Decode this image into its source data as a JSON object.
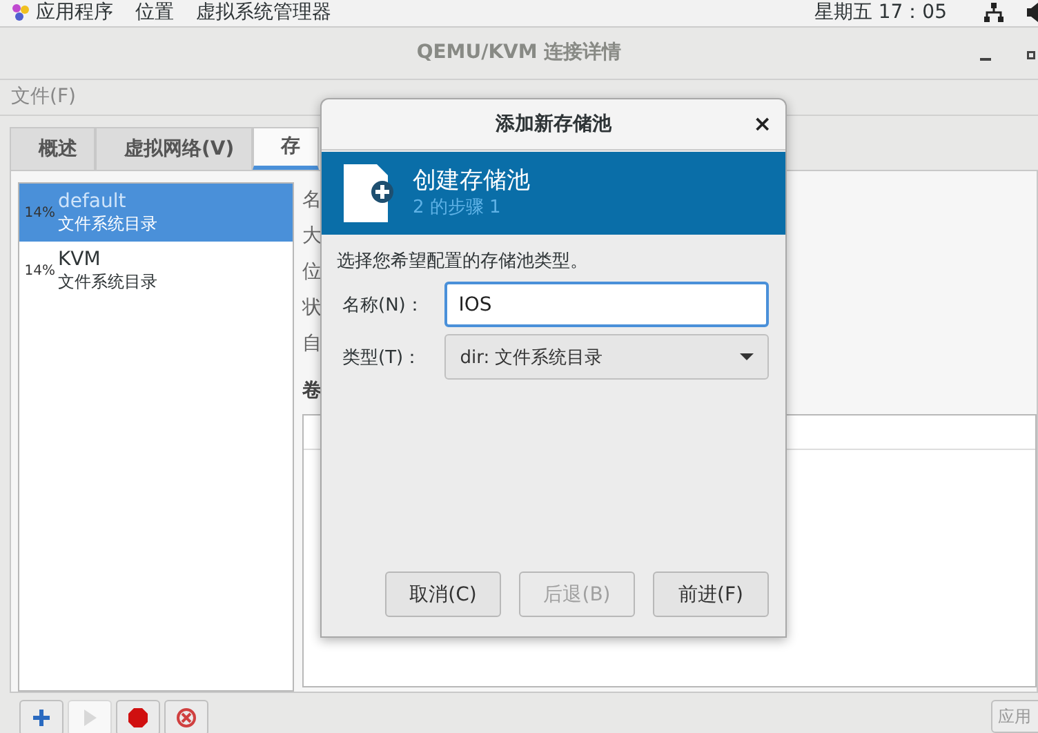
{
  "top_bar": {
    "menus": [
      "应用程序",
      "位置",
      "虚拟系统管理器"
    ],
    "clock": "星期五 17：05"
  },
  "window": {
    "title": "QEMU/KVM 连接详情"
  },
  "menu_bar": [
    "文件(F)"
  ],
  "tabs": [
    {
      "label": "概述",
      "selected": false
    },
    {
      "label": "虚拟网络(V)",
      "selected": false
    },
    {
      "label": "存",
      "selected": true
    }
  ],
  "pools": [
    {
      "usage": "14%",
      "name": "default",
      "type": "文件系统目录",
      "selected": true
    },
    {
      "usage": "14%",
      "name": "KVM",
      "type": "文件系统目录",
      "selected": false
    }
  ],
  "detail_labels": [
    "名",
    "大",
    "位",
    "状",
    "自"
  ],
  "volumes_label": "卷",
  "toolbar": [
    {
      "kind": "add",
      "disabled": false
    },
    {
      "kind": "start",
      "disabled": true
    },
    {
      "kind": "stop",
      "disabled": false
    },
    {
      "kind": "delete",
      "disabled": false
    }
  ],
  "apply_button": "应用",
  "dialog": {
    "title": "添加新存储池",
    "close": "×",
    "heading": "创建存储池",
    "step": "2 的步骤 1",
    "description": "选择您希望配置的存储池类型。",
    "name_label": "名称(N)：",
    "name_value": "IOS",
    "type_label": "类型(T)：",
    "type_value": "dir: 文件系统目录",
    "buttons": [
      {
        "label": "取消(C)",
        "disabled": false
      },
      {
        "label": "后退(B)",
        "disabled": true
      },
      {
        "label": "前进(F)",
        "disabled": false
      }
    ]
  }
}
